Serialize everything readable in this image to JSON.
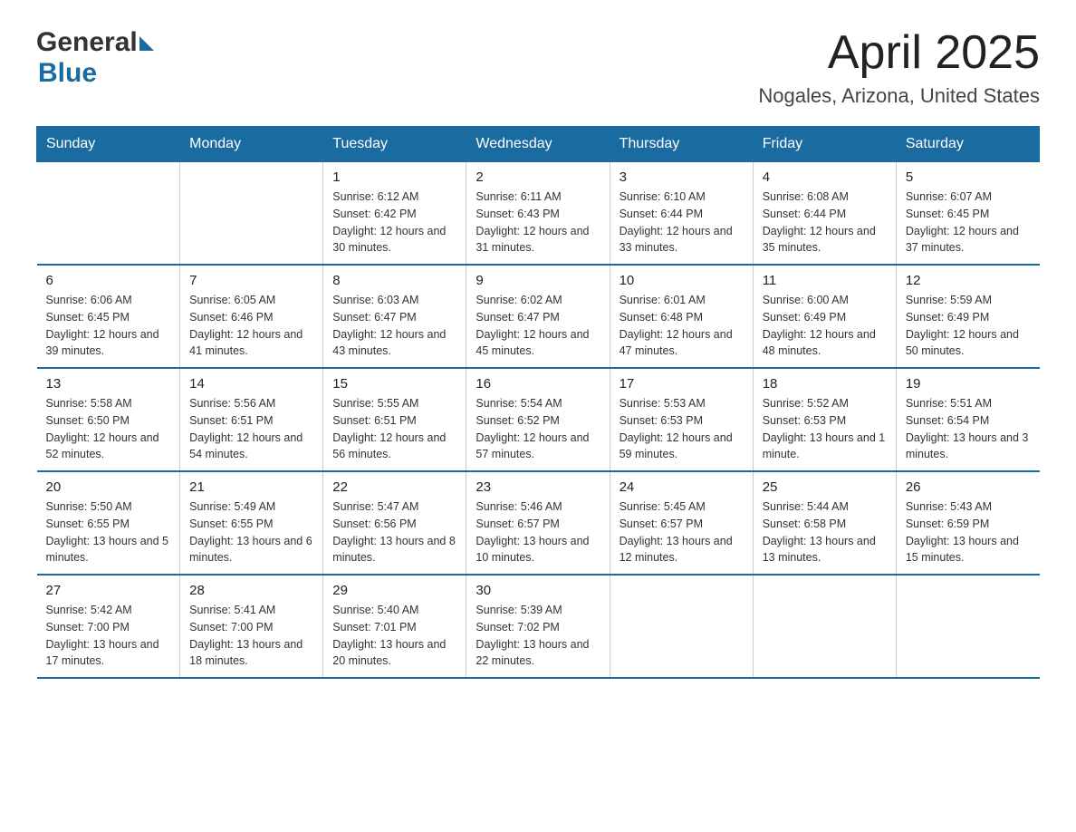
{
  "header": {
    "title": "April 2025",
    "subtitle": "Nogales, Arizona, United States",
    "logo_general": "General",
    "logo_blue": "Blue"
  },
  "days_of_week": [
    "Sunday",
    "Monday",
    "Tuesday",
    "Wednesday",
    "Thursday",
    "Friday",
    "Saturday"
  ],
  "weeks": [
    [
      {
        "day": "",
        "sunrise": "",
        "sunset": "",
        "daylight": ""
      },
      {
        "day": "",
        "sunrise": "",
        "sunset": "",
        "daylight": ""
      },
      {
        "day": "1",
        "sunrise": "Sunrise: 6:12 AM",
        "sunset": "Sunset: 6:42 PM",
        "daylight": "Daylight: 12 hours and 30 minutes."
      },
      {
        "day": "2",
        "sunrise": "Sunrise: 6:11 AM",
        "sunset": "Sunset: 6:43 PM",
        "daylight": "Daylight: 12 hours and 31 minutes."
      },
      {
        "day": "3",
        "sunrise": "Sunrise: 6:10 AM",
        "sunset": "Sunset: 6:44 PM",
        "daylight": "Daylight: 12 hours and 33 minutes."
      },
      {
        "day": "4",
        "sunrise": "Sunrise: 6:08 AM",
        "sunset": "Sunset: 6:44 PM",
        "daylight": "Daylight: 12 hours and 35 minutes."
      },
      {
        "day": "5",
        "sunrise": "Sunrise: 6:07 AM",
        "sunset": "Sunset: 6:45 PM",
        "daylight": "Daylight: 12 hours and 37 minutes."
      }
    ],
    [
      {
        "day": "6",
        "sunrise": "Sunrise: 6:06 AM",
        "sunset": "Sunset: 6:45 PM",
        "daylight": "Daylight: 12 hours and 39 minutes."
      },
      {
        "day": "7",
        "sunrise": "Sunrise: 6:05 AM",
        "sunset": "Sunset: 6:46 PM",
        "daylight": "Daylight: 12 hours and 41 minutes."
      },
      {
        "day": "8",
        "sunrise": "Sunrise: 6:03 AM",
        "sunset": "Sunset: 6:47 PM",
        "daylight": "Daylight: 12 hours and 43 minutes."
      },
      {
        "day": "9",
        "sunrise": "Sunrise: 6:02 AM",
        "sunset": "Sunset: 6:47 PM",
        "daylight": "Daylight: 12 hours and 45 minutes."
      },
      {
        "day": "10",
        "sunrise": "Sunrise: 6:01 AM",
        "sunset": "Sunset: 6:48 PM",
        "daylight": "Daylight: 12 hours and 47 minutes."
      },
      {
        "day": "11",
        "sunrise": "Sunrise: 6:00 AM",
        "sunset": "Sunset: 6:49 PM",
        "daylight": "Daylight: 12 hours and 48 minutes."
      },
      {
        "day": "12",
        "sunrise": "Sunrise: 5:59 AM",
        "sunset": "Sunset: 6:49 PM",
        "daylight": "Daylight: 12 hours and 50 minutes."
      }
    ],
    [
      {
        "day": "13",
        "sunrise": "Sunrise: 5:58 AM",
        "sunset": "Sunset: 6:50 PM",
        "daylight": "Daylight: 12 hours and 52 minutes."
      },
      {
        "day": "14",
        "sunrise": "Sunrise: 5:56 AM",
        "sunset": "Sunset: 6:51 PM",
        "daylight": "Daylight: 12 hours and 54 minutes."
      },
      {
        "day": "15",
        "sunrise": "Sunrise: 5:55 AM",
        "sunset": "Sunset: 6:51 PM",
        "daylight": "Daylight: 12 hours and 56 minutes."
      },
      {
        "day": "16",
        "sunrise": "Sunrise: 5:54 AM",
        "sunset": "Sunset: 6:52 PM",
        "daylight": "Daylight: 12 hours and 57 minutes."
      },
      {
        "day": "17",
        "sunrise": "Sunrise: 5:53 AM",
        "sunset": "Sunset: 6:53 PM",
        "daylight": "Daylight: 12 hours and 59 minutes."
      },
      {
        "day": "18",
        "sunrise": "Sunrise: 5:52 AM",
        "sunset": "Sunset: 6:53 PM",
        "daylight": "Daylight: 13 hours and 1 minute."
      },
      {
        "day": "19",
        "sunrise": "Sunrise: 5:51 AM",
        "sunset": "Sunset: 6:54 PM",
        "daylight": "Daylight: 13 hours and 3 minutes."
      }
    ],
    [
      {
        "day": "20",
        "sunrise": "Sunrise: 5:50 AM",
        "sunset": "Sunset: 6:55 PM",
        "daylight": "Daylight: 13 hours and 5 minutes."
      },
      {
        "day": "21",
        "sunrise": "Sunrise: 5:49 AM",
        "sunset": "Sunset: 6:55 PM",
        "daylight": "Daylight: 13 hours and 6 minutes."
      },
      {
        "day": "22",
        "sunrise": "Sunrise: 5:47 AM",
        "sunset": "Sunset: 6:56 PM",
        "daylight": "Daylight: 13 hours and 8 minutes."
      },
      {
        "day": "23",
        "sunrise": "Sunrise: 5:46 AM",
        "sunset": "Sunset: 6:57 PM",
        "daylight": "Daylight: 13 hours and 10 minutes."
      },
      {
        "day": "24",
        "sunrise": "Sunrise: 5:45 AM",
        "sunset": "Sunset: 6:57 PM",
        "daylight": "Daylight: 13 hours and 12 minutes."
      },
      {
        "day": "25",
        "sunrise": "Sunrise: 5:44 AM",
        "sunset": "Sunset: 6:58 PM",
        "daylight": "Daylight: 13 hours and 13 minutes."
      },
      {
        "day": "26",
        "sunrise": "Sunrise: 5:43 AM",
        "sunset": "Sunset: 6:59 PM",
        "daylight": "Daylight: 13 hours and 15 minutes."
      }
    ],
    [
      {
        "day": "27",
        "sunrise": "Sunrise: 5:42 AM",
        "sunset": "Sunset: 7:00 PM",
        "daylight": "Daylight: 13 hours and 17 minutes."
      },
      {
        "day": "28",
        "sunrise": "Sunrise: 5:41 AM",
        "sunset": "Sunset: 7:00 PM",
        "daylight": "Daylight: 13 hours and 18 minutes."
      },
      {
        "day": "29",
        "sunrise": "Sunrise: 5:40 AM",
        "sunset": "Sunset: 7:01 PM",
        "daylight": "Daylight: 13 hours and 20 minutes."
      },
      {
        "day": "30",
        "sunrise": "Sunrise: 5:39 AM",
        "sunset": "Sunset: 7:02 PM",
        "daylight": "Daylight: 13 hours and 22 minutes."
      },
      {
        "day": "",
        "sunrise": "",
        "sunset": "",
        "daylight": ""
      },
      {
        "day": "",
        "sunrise": "",
        "sunset": "",
        "daylight": ""
      },
      {
        "day": "",
        "sunrise": "",
        "sunset": "",
        "daylight": ""
      }
    ]
  ]
}
